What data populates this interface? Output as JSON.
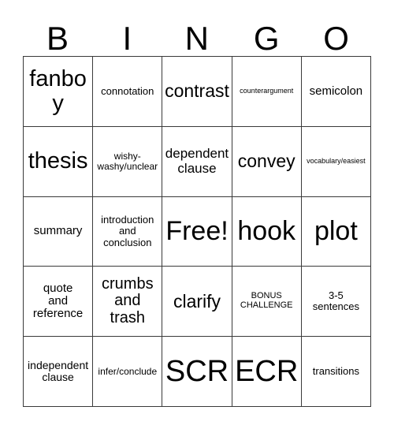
{
  "card": {
    "title_letters": [
      "B",
      "I",
      "N",
      "G",
      "O"
    ],
    "grid_size": "5x5",
    "free_space_label": "Free!",
    "border_color": "#3a3a3a",
    "background_color": "#ffffff",
    "text_color": "#000000",
    "rows": [
      [
        {
          "text": "fanboy",
          "size": "fs-lg"
        },
        {
          "text": "connotation",
          "size": "fs-4xs"
        },
        {
          "text": "contrast",
          "size": "fs-md"
        },
        {
          "text": "counterargument",
          "size": "fs-7xs"
        },
        {
          "text": "semicolon",
          "size": "fs-xxs"
        }
      ],
      [
        {
          "text": "thesis",
          "size": "fs-lg"
        },
        {
          "text": "wishy-\nwashy/unclear",
          "size": "fs-5xs"
        },
        {
          "text": "dependent\nclause",
          "size": "fs-xs"
        },
        {
          "text": "convey",
          "size": "fs-md"
        },
        {
          "text": "vocabulary/easiest",
          "size": "fs-7xs"
        }
      ],
      [
        {
          "text": "summary",
          "size": "fs-xxs"
        },
        {
          "text": "introduction\nand\nconclusion",
          "size": "fs-4xs"
        },
        {
          "text": "Free!",
          "size": "fs-xl"
        },
        {
          "text": "hook",
          "size": "fs-xl"
        },
        {
          "text": "plot",
          "size": "fs-xl"
        }
      ],
      [
        {
          "text": "quote\nand\nreference",
          "size": "fs-xxs"
        },
        {
          "text": "crumbs\nand\ntrash",
          "size": "fs-sm"
        },
        {
          "text": "clarify",
          "size": "fs-md"
        },
        {
          "text": "BONUS\nCHALLENGE",
          "size": "fs-6xs"
        },
        {
          "text": "3-5\nsentences",
          "size": "fs-4xs"
        }
      ],
      [
        {
          "text": "independent\nclause",
          "size": "fs-3xs"
        },
        {
          "text": "infer/conclude",
          "size": "fs-5xs"
        },
        {
          "text": "SCR",
          "size": "fs-xxl"
        },
        {
          "text": "ECR",
          "size": "fs-xxl"
        },
        {
          "text": "transitions",
          "size": "fs-4xs"
        }
      ]
    ]
  }
}
